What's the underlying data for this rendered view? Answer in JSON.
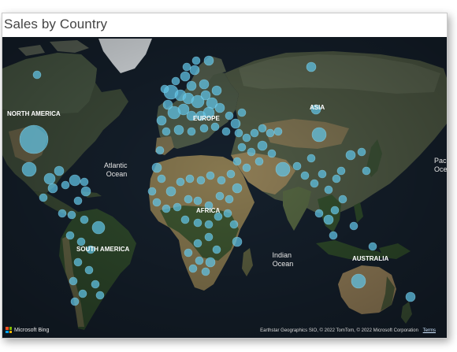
{
  "visual": {
    "title": "Sales by Country"
  },
  "map": {
    "labels": {
      "north_america": "NORTH AMERICA",
      "europe": "EUROPE",
      "asia": "ASIA",
      "atlantic": "Atlantic\nOcean",
      "africa": "AFRICA",
      "south_america": "SOUTH AMERICA",
      "indian": "Indian\nOcean",
      "australia": "AUSTRALIA",
      "pacific": "Paci\nOce"
    },
    "bubble_color": "#5fc3e6",
    "ocean_color": "#15202c",
    "land_color": "#3b4a3a",
    "desert_color": "#8a7a55",
    "ice_color": "#e8ecef"
  },
  "footer": {
    "brand": "Microsoft Bing",
    "attribution": "Earthstar Geographics SIO, © 2022 TomTom, © 2022 Microsoft Corporation",
    "terms": "Terms"
  }
}
